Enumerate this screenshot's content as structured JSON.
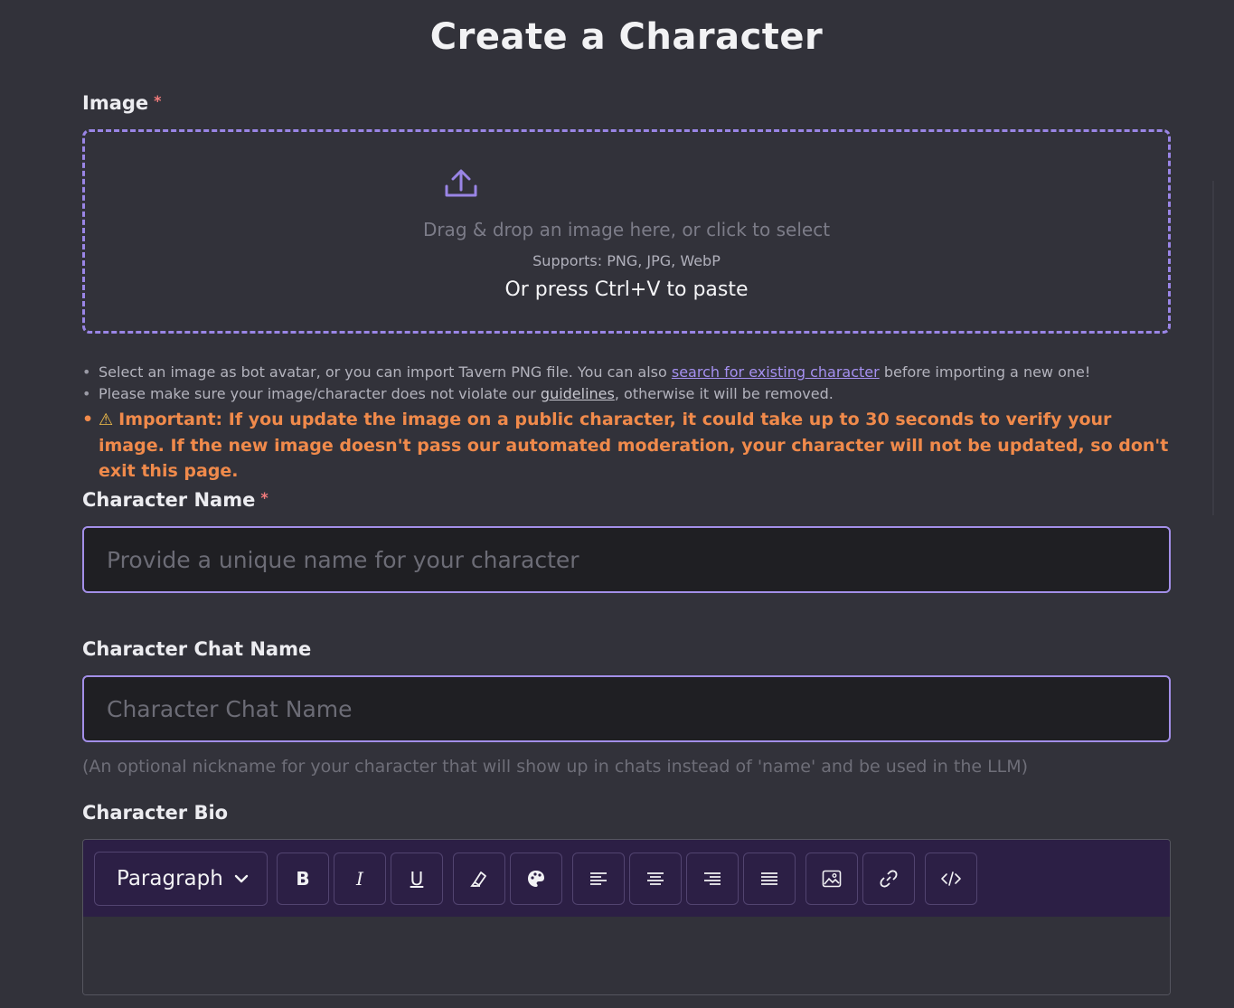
{
  "page": {
    "title": "Create a Character"
  },
  "image": {
    "label": "Image",
    "required_mark": "*",
    "icon": "upload-icon",
    "drop_text": "Drag & drop an image here, or click to select",
    "supports_text": "Supports: PNG, JPG, WebP",
    "paste_text": "Or press Ctrl+V to paste"
  },
  "notes": {
    "line1_before": "Select an image as bot avatar, or you can import Tavern PNG file. You can also ",
    "line1_link": "search for existing character",
    "line1_after": " before importing a new one!",
    "line2_before": "Please make sure your image/character does not violate our ",
    "line2_link": "guidelines",
    "line2_after": ", otherwise it will be removed.",
    "warning_icon": "warning-icon",
    "warning_strong": "Important:",
    "warning_text": " If you update the image on a public character, it could take up to 30 seconds to verify your image. If the new image doesn't pass our automated moderation, your character will not be updated, so don't exit this page."
  },
  "name": {
    "label": "Character Name",
    "required_mark": "*",
    "placeholder": "Provide a unique name for your character"
  },
  "chat_name": {
    "label": "Character Chat Name",
    "placeholder": "Character Chat Name",
    "helper": "(An optional nickname for your character that will show up in chats instead of 'name' and be used in the LLM)"
  },
  "bio": {
    "label": "Character Bio",
    "block_type": "Paragraph",
    "toolbar": {
      "bold": "B",
      "italic": "I",
      "underline": "U"
    }
  },
  "colors": {
    "accent": "#a38fe8",
    "warning": "#f08a4b",
    "toolbar_bg": "#2c1f45",
    "required": "#f27b7b"
  }
}
